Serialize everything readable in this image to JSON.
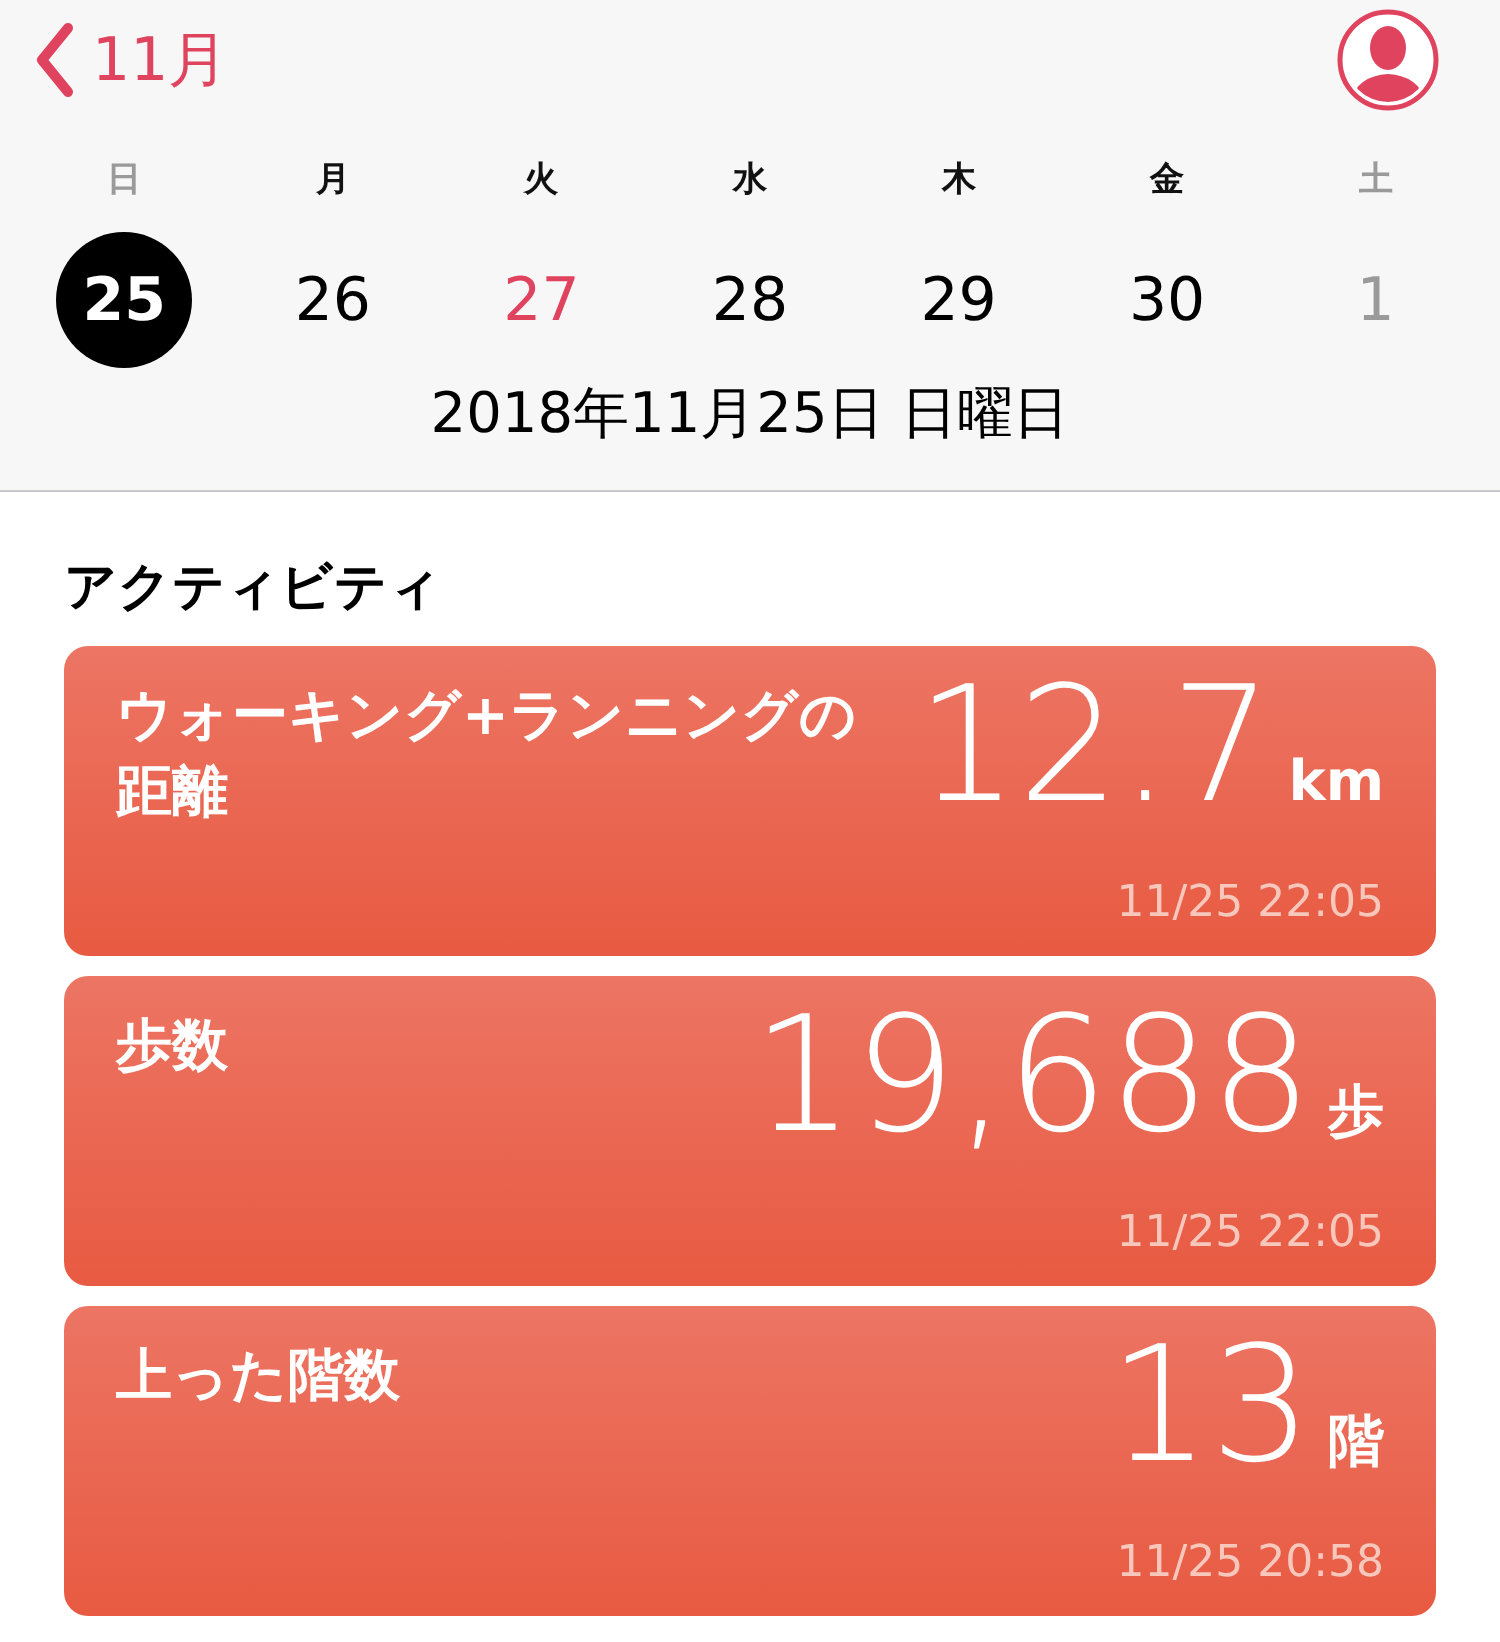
{
  "nav": {
    "back_label": "11月"
  },
  "week": [
    {
      "weekday": "日",
      "date": "25",
      "weekend": true,
      "today": false,
      "selected": true
    },
    {
      "weekday": "月",
      "date": "26",
      "weekend": false,
      "today": false,
      "selected": false
    },
    {
      "weekday": "火",
      "date": "27",
      "weekend": false,
      "today": true,
      "selected": false
    },
    {
      "weekday": "水",
      "date": "28",
      "weekend": false,
      "today": false,
      "selected": false
    },
    {
      "weekday": "木",
      "date": "29",
      "weekend": false,
      "today": false,
      "selected": false
    },
    {
      "weekday": "金",
      "date": "30",
      "weekend": false,
      "today": false,
      "selected": false
    },
    {
      "weekday": "土",
      "date": "1",
      "weekend": true,
      "today": false,
      "selected": false
    }
  ],
  "full_date": "2018年11月25日 日曜日",
  "section_title": "アクティビティ",
  "cards": [
    {
      "title": "ウォーキング+ランニングの距離",
      "value": "12.7",
      "unit": "km",
      "time": "11/25 22:05"
    },
    {
      "title": "歩数",
      "value": "19,688",
      "unit": "歩",
      "time": "11/25 22:05"
    },
    {
      "title": "上った階数",
      "value": "13",
      "unit": "階",
      "time": "11/25 20:58"
    }
  ]
}
